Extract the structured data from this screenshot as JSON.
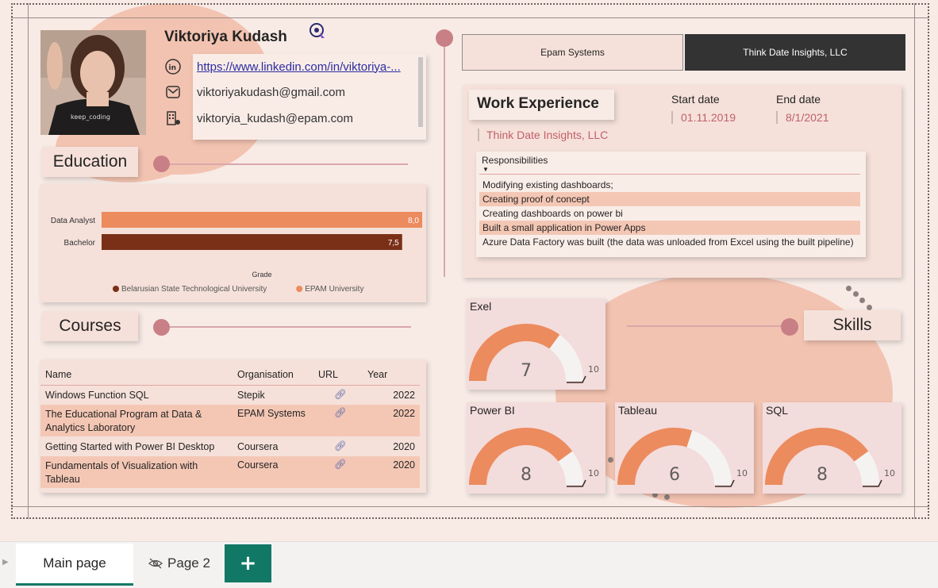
{
  "profile": {
    "name": "Viktoriya Kudash",
    "linkedin": "https://www.linkedin.com/in/viktoriya-...",
    "email_personal": "viktoriyakudash@gmail.com",
    "email_work": "viktoryia_kudash@epam.com"
  },
  "sections": {
    "education": "Education",
    "courses": "Courses",
    "work_experience": "Work Experience",
    "skills": "Skills"
  },
  "education_chart": {
    "chart_data": {
      "type": "bar",
      "orientation": "horizontal",
      "categories": [
        "Data Analyst",
        "Bachelor"
      ],
      "values": [
        8.0,
        7.5
      ],
      "value_labels": [
        "8,0",
        "7,5"
      ],
      "colors": [
        "#ec8b5e",
        "#7a3017"
      ],
      "xlabel": "Grade",
      "xlim": [
        0,
        8
      ],
      "legend": [
        {
          "name": "Belarusian State  Technological University",
          "color": "#7a3017"
        },
        {
          "name": "EPAM University",
          "color": "#ec8b5e"
        }
      ],
      "legend_position": "bottom"
    }
  },
  "courses_table": {
    "columns": [
      "Name",
      "Organisation",
      "URL",
      "Year"
    ],
    "rows": [
      {
        "name": "Windows Function SQL",
        "org": "Stepik",
        "year": "2022"
      },
      {
        "name": "The Educational Program at Data & Analytics Laboratory",
        "org": "EPAM Systems",
        "year": "2022"
      },
      {
        "name": "Getting Started with Power BI Desktop",
        "org": "Coursera",
        "year": "2020"
      },
      {
        "name": "Fundamentals of Visualization with Tableau",
        "org": "Coursera",
        "year": "2020"
      }
    ]
  },
  "company_tabs": [
    {
      "label": "Epam Systems",
      "selected": false
    },
    {
      "label": "Think Date Insights, LLC",
      "selected": true
    }
  ],
  "work": {
    "start_date_label": "Start date",
    "end_date_label": "End date",
    "start_date": "01.11.2019",
    "end_date": "8/1/2021",
    "company": "Think Date Insights, LLC",
    "responsibilities_header": "Responsibilities",
    "responsibilities": [
      "Modifying existing dashboards;",
      "Creating proof of concept",
      "Creating dashboards on power bi",
      "Built a small application in Power Apps",
      "Azure Data Factory was built (the data was unloaded from Excel using the built pipeline)"
    ]
  },
  "skills": [
    {
      "name": "Exel",
      "value": "7",
      "max": "10",
      "fraction": 0.7
    },
    {
      "name": "Power BI",
      "value": "8",
      "max": "10",
      "fraction": 0.8
    },
    {
      "name": "Tableau",
      "value": "6",
      "max": "10",
      "fraction": 0.6
    },
    {
      "name": "SQL",
      "value": "8",
      "max": "10",
      "fraction": 0.8
    }
  ],
  "page_tabs": {
    "main": "Main page",
    "page2": "Page 2",
    "add": "+"
  },
  "colors": {
    "accent_orange": "#ec8b5e",
    "accent_brown": "#7a3017",
    "dark_tab": "#333333",
    "add_tab": "#117865",
    "rose": "#c97f86"
  }
}
